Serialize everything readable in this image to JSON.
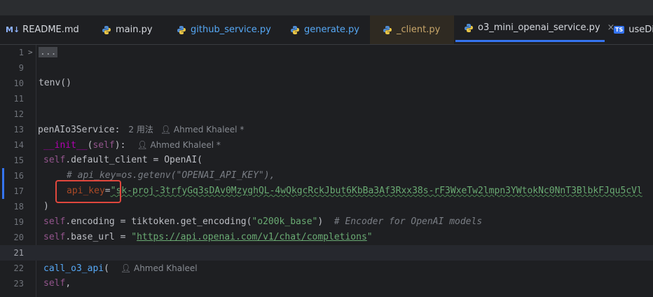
{
  "tabs": [
    {
      "badge": "M↓",
      "label": "README.md",
      "kind": "markdown"
    },
    {
      "label": "main.py",
      "kind": "python"
    },
    {
      "label": "github_service.py",
      "kind": "python"
    },
    {
      "label": "generate.py",
      "kind": "python"
    },
    {
      "label": "_client.py",
      "kind": "python-modified"
    },
    {
      "label": "o3_mini_openai_service.py",
      "kind": "python-active",
      "close": "×"
    },
    {
      "badge": "TS",
      "label": "useDia",
      "kind": "typescript"
    }
  ],
  "lines": {
    "l1": {
      "num": "1",
      "fold": "...",
      "arrow": ">"
    },
    "l9": {
      "num": "9"
    },
    "l10": {
      "num": "10",
      "text": "tenv()"
    },
    "l11": {
      "num": "11"
    },
    "l12": {
      "num": "12"
    },
    "l13": {
      "num": "13",
      "name": "penAIo3Service",
      "colon": ":",
      "usages": "2 用法",
      "author": "Ahmed Khaleel *"
    },
    "l14": {
      "num": "14",
      "name": "__init__",
      "params": "self",
      "author": "Ahmed Khaleel *"
    },
    "l15": {
      "num": "15",
      "self": "self",
      "attr": ".default_client = OpenAI("
    },
    "l16": {
      "num": "16",
      "comment": "# api_key=os.getenv(\"OPENAI_API_KEY\"),"
    },
    "l17": {
      "num": "17",
      "param": "api_key",
      "eq": "=",
      "value": "\"sk-proj-3trfyGq3sDAv0MzyghQL-4wQkgcRckJbut6KbBa3Af3Rxx38s-rF3WxeTw2lmpn3YWtokNc0NnT3BlbkFJqu5cVl"
    },
    "l18": {
      "num": "18",
      "text": ")"
    },
    "l19": {
      "num": "19",
      "self": "self",
      "attr": ".encoding = tiktoken.get_encoding(",
      "str": "\"o200k_base\"",
      "close": ")",
      "comment": "# Encoder for OpenAI models"
    },
    "l20": {
      "num": "20",
      "self": "self",
      "attr": ".base_url = ",
      "q1": "\"",
      "url": "https://api.openai.com/v1/chat/completions",
      "q2": "\""
    },
    "l21": {
      "num": "21"
    },
    "l22": {
      "num": "22",
      "name": "call_o3_api",
      "paren": "(",
      "author": "Ahmed Khaleel"
    },
    "l23": {
      "num": "23",
      "self": "self",
      "comma": ","
    }
  },
  "colors": {
    "background": "#1e1f22",
    "accent": "#3574f0",
    "highlight_box": "#e0473d"
  }
}
